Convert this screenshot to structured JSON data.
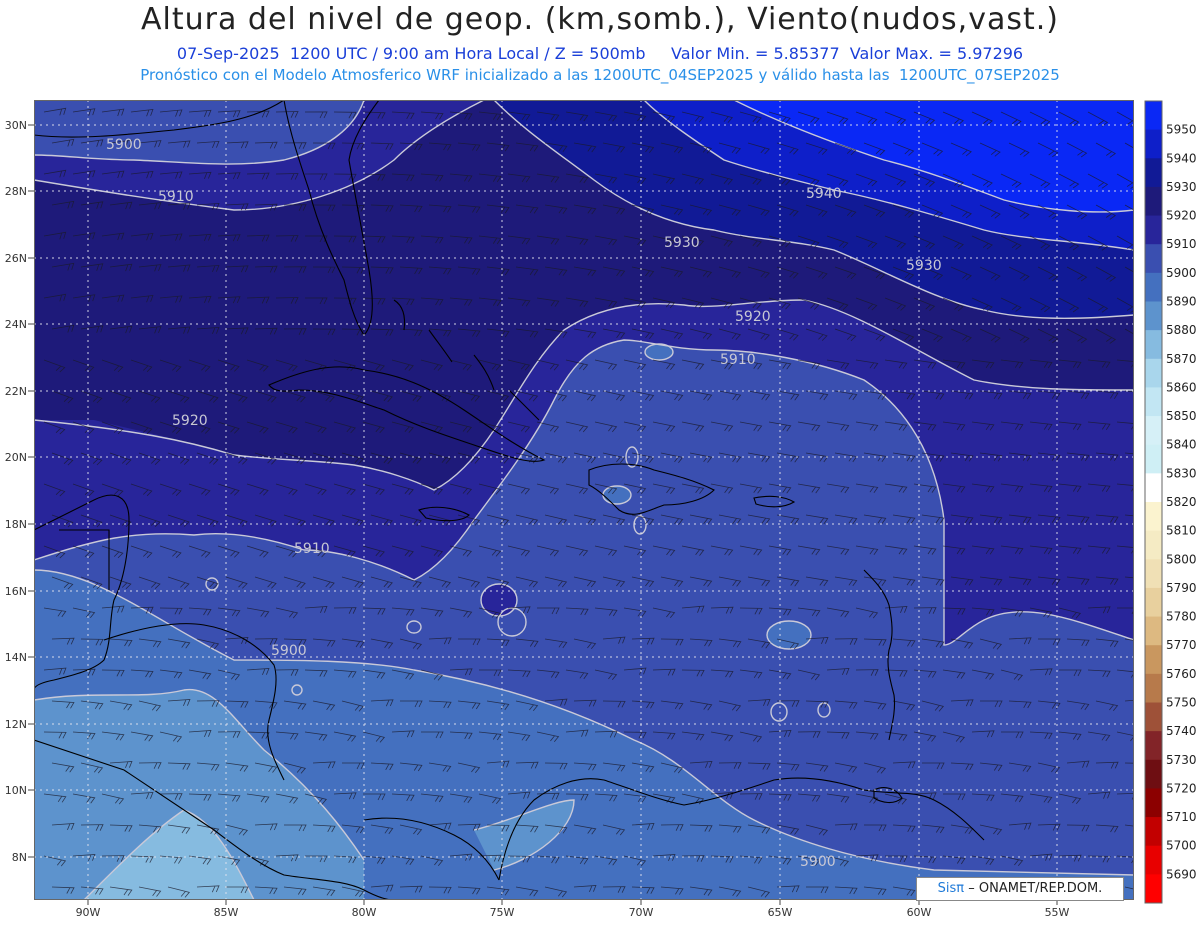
{
  "header": {
    "title": "Altura del nivel de geop. (km,somb.), Viento(nudos,vast.)",
    "date": "07-Sep-2025",
    "time": "1200 UTC / 9:00 am Hora Local / Z = 500mb",
    "min_label": "Valor Min. = 5.85377",
    "max_label": "Valor Max. = 5.97296",
    "model_line": "Pronóstico con el Modelo Atmosferico WRF inicializado a las 1200UTC_04SEP2025 y válido hasta las  1200UTC_07SEP2025"
  },
  "map": {
    "lat_labels": [
      "30N",
      "28N",
      "26N",
      "24N",
      "22N",
      "20N",
      "18N",
      "16N",
      "14N",
      "12N",
      "10N",
      "8N"
    ],
    "lon_labels": [
      "90W",
      "85W",
      "80W",
      "75W",
      "70W",
      "65W",
      "60W",
      "55W"
    ],
    "contour_labels": [
      {
        "text": "5900"
      },
      {
        "text": "5910"
      },
      {
        "text": "5930"
      },
      {
        "text": "5940"
      },
      {
        "text": "5930"
      },
      {
        "text": "5920"
      },
      {
        "text": "5910"
      },
      {
        "text": "5920"
      },
      {
        "text": "5910"
      },
      {
        "text": "5900"
      },
      {
        "text": "5900"
      }
    ]
  },
  "colorbar": {
    "levels": [
      {
        "value": "5950",
        "color": "#0a28f5"
      },
      {
        "value": "5940",
        "color": "#0e1fc9"
      },
      {
        "value": "5930",
        "color": "#111a96"
      },
      {
        "value": "5920",
        "color": "#1e1a7a"
      },
      {
        "value": "5910",
        "color": "#28259a"
      },
      {
        "value": "5900",
        "color": "#3a4fb0"
      },
      {
        "value": "5890",
        "color": "#4470bf"
      },
      {
        "value": "5880",
        "color": "#5d93cd"
      },
      {
        "value": "5870",
        "color": "#86bbe0"
      },
      {
        "value": "5860",
        "color": "#a9d6ec"
      },
      {
        "value": "5850",
        "color": "#c2e6f3"
      },
      {
        "value": "5840",
        "color": "#d6f0f7"
      },
      {
        "value": "5830",
        "color": "#cfeff5"
      },
      {
        "value": "5820",
        "color": "#ffffff"
      },
      {
        "value": "5810",
        "color": "#fbf3cf"
      },
      {
        "value": "5800",
        "color": "#f5ebc4"
      },
      {
        "value": "5790",
        "color": "#f0e0b5"
      },
      {
        "value": "5780",
        "color": "#e8d09e"
      },
      {
        "value": "5770",
        "color": "#ddb981"
      },
      {
        "value": "5760",
        "color": "#c9975f"
      },
      {
        "value": "5750",
        "color": "#b77a4b"
      },
      {
        "value": "5740",
        "color": "#9e5138"
      },
      {
        "value": "5730",
        "color": "#822428"
      },
      {
        "value": "5720",
        "color": "#6e0e12"
      },
      {
        "value": "5710",
        "color": "#8c0000"
      },
      {
        "value": "5700",
        "color": "#c20000"
      },
      {
        "value": "5690",
        "color": "#e80000"
      },
      {
        "value": "",
        "color": "#ff0000"
      }
    ]
  },
  "credit": {
    "logo": "Sisπ",
    "text": "– ONAMET/REP.DOM."
  }
}
